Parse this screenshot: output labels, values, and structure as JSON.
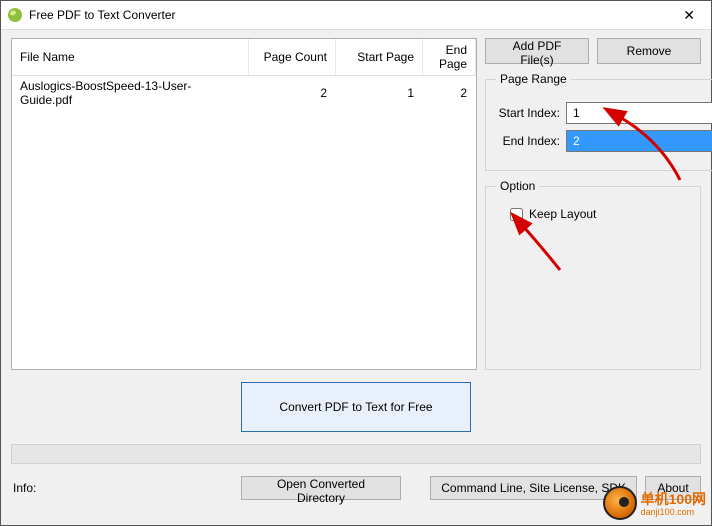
{
  "window": {
    "title": "Free PDF to Text Converter",
    "close_glyph": "✕"
  },
  "table": {
    "headers": {
      "file_name": "File Name",
      "page_count": "Page Count",
      "start_page": "Start Page",
      "end_page": "End Page"
    },
    "rows": [
      {
        "file_name": "Auslogics-BoostSpeed-13-User-Guide.pdf",
        "page_count": "2",
        "start_page": "1",
        "end_page": "2"
      }
    ]
  },
  "buttons": {
    "add": "Add PDF File(s)",
    "remove": "Remove",
    "convert": "Convert PDF to Text for Free",
    "open_dir": "Open Converted Directory",
    "cmd_line": "Command Line, Site License, SDK",
    "about": "About"
  },
  "page_range": {
    "legend": "Page Range",
    "start_label": "Start Index:",
    "start_value": "1",
    "end_label": "End Index:",
    "end_value": "2"
  },
  "option": {
    "legend": "Option",
    "keep_layout_label": "Keep Layout",
    "keep_layout_checked": false
  },
  "footer": {
    "info_label": "Info:"
  },
  "watermark": {
    "text": "单机100网",
    "sub": "danji100.com"
  }
}
